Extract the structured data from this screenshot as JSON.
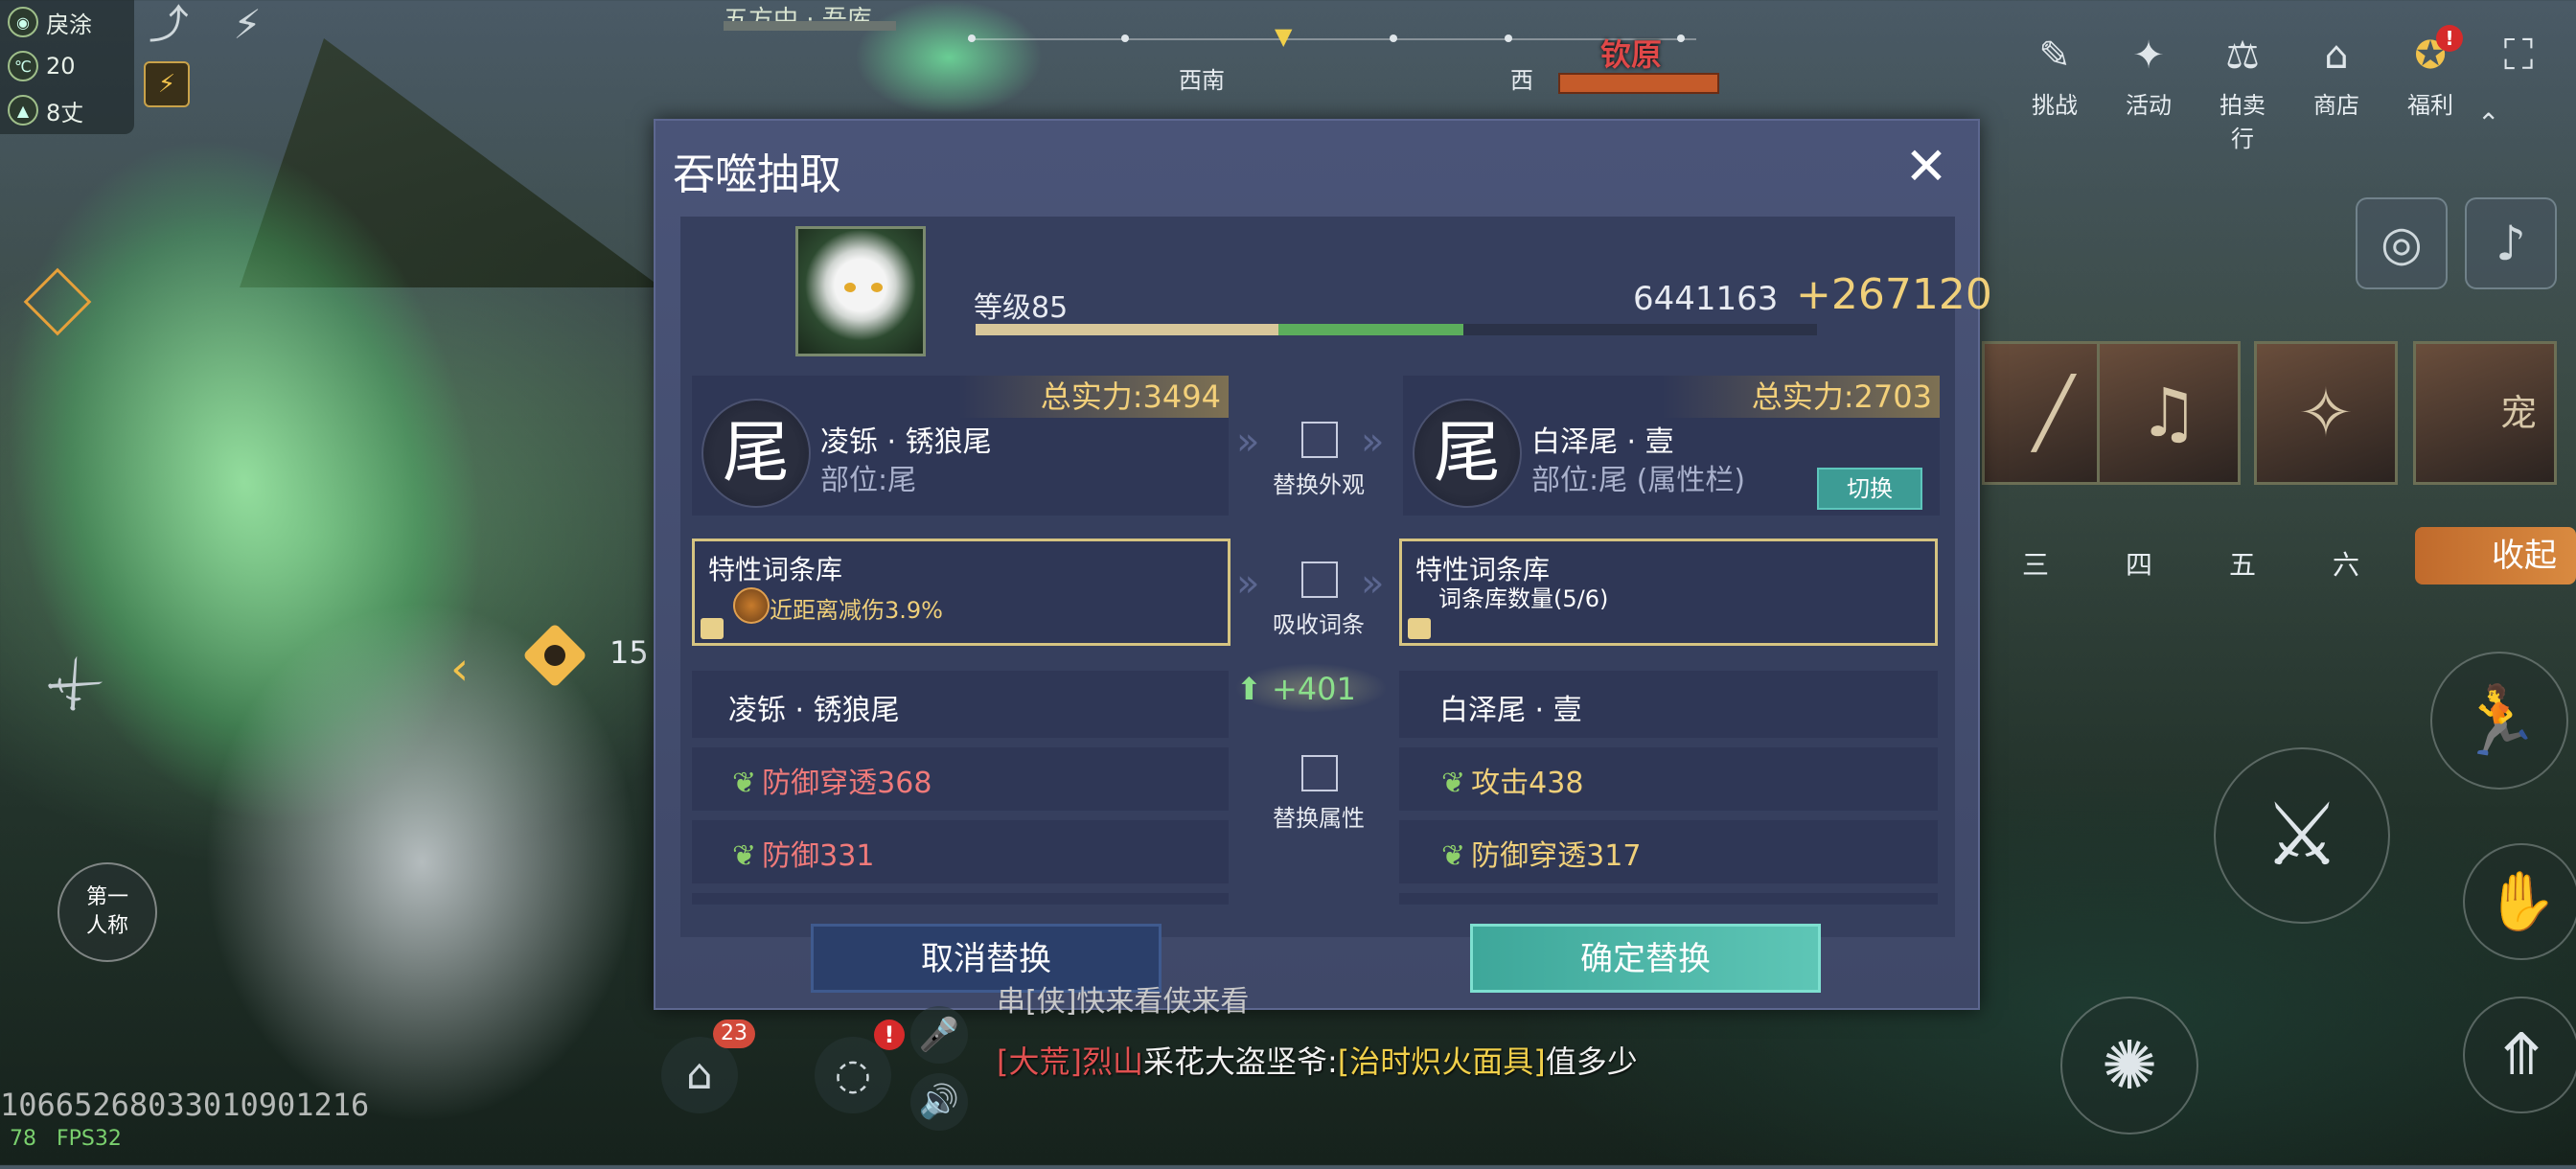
{
  "hud": {
    "time_label": "戾涂",
    "temperature": "20",
    "distance": "8丈",
    "compass": [
      "西南",
      "西"
    ],
    "location": "钦原",
    "quest_label": "五方中 · 吾库",
    "num_marker": "15",
    "first_person": "第一人称"
  },
  "menu": {
    "items": [
      {
        "label": "挑战",
        "icon": "challenge-icon"
      },
      {
        "label": "活动",
        "icon": "activity-icon"
      },
      {
        "label": "拍卖行",
        "icon": "auction-icon"
      },
      {
        "label": "商店",
        "icon": "shop-icon"
      },
      {
        "label": "福利",
        "icon": "welfare-icon",
        "badge": "!"
      }
    ]
  },
  "slots": {
    "numbers": [
      "三",
      "四",
      "五",
      "六"
    ],
    "pet_label": "宠",
    "collapse": "收起"
  },
  "chat": {
    "line0": "串[侠]快来看侠来看",
    "channel": "[大荒]",
    "name": "烈山",
    "speaker": "采花大盗坚爷:",
    "item": "[治时炽火面具]",
    "message": "值多少"
  },
  "bottom": {
    "uid": "10665268033010901216",
    "fps_label": "FPS32",
    "ping": "78",
    "mail_badge": "23",
    "alert_badge": "!"
  },
  "dialog": {
    "title": "吞噬抽取",
    "pet": {
      "level": "等级85",
      "exp": "6441163",
      "gain": "+267120",
      "exp_fraction": 0.36,
      "gain_fraction": 0.22
    },
    "left_item": {
      "glyph": "尾",
      "power": "总实力:3494",
      "name": "凌铄 · 锈狼尾",
      "part": "部位:尾"
    },
    "right_item": {
      "glyph": "尾",
      "power": "总实力:2703",
      "name": "白泽尾 · 壹",
      "part": "部位:尾 (属性栏)",
      "switch": "切换"
    },
    "replace_look": "替换外观",
    "absorb_traits": "吸收词条",
    "replace_attrs": "替换属性",
    "left_trait": {
      "title": "特性词条库",
      "value": "近距离减伤3.9%"
    },
    "right_trait": {
      "title": "特性词条库",
      "value": "词条库数量(5/6)"
    },
    "diff": "+401",
    "left_attrs": {
      "head": "凌铄 · 锈狼尾",
      "a1": "防御穿透368",
      "a2": "防御331"
    },
    "right_attrs": {
      "head": "白泽尾 · 壹",
      "a1": "攻击438",
      "a2": "防御穿透317"
    },
    "cancel": "取消替换",
    "confirm": "确定替换",
    "colors": {
      "bad": "#f07a7a",
      "good": "#f0d07a",
      "accent": "#5ec6b6"
    }
  }
}
